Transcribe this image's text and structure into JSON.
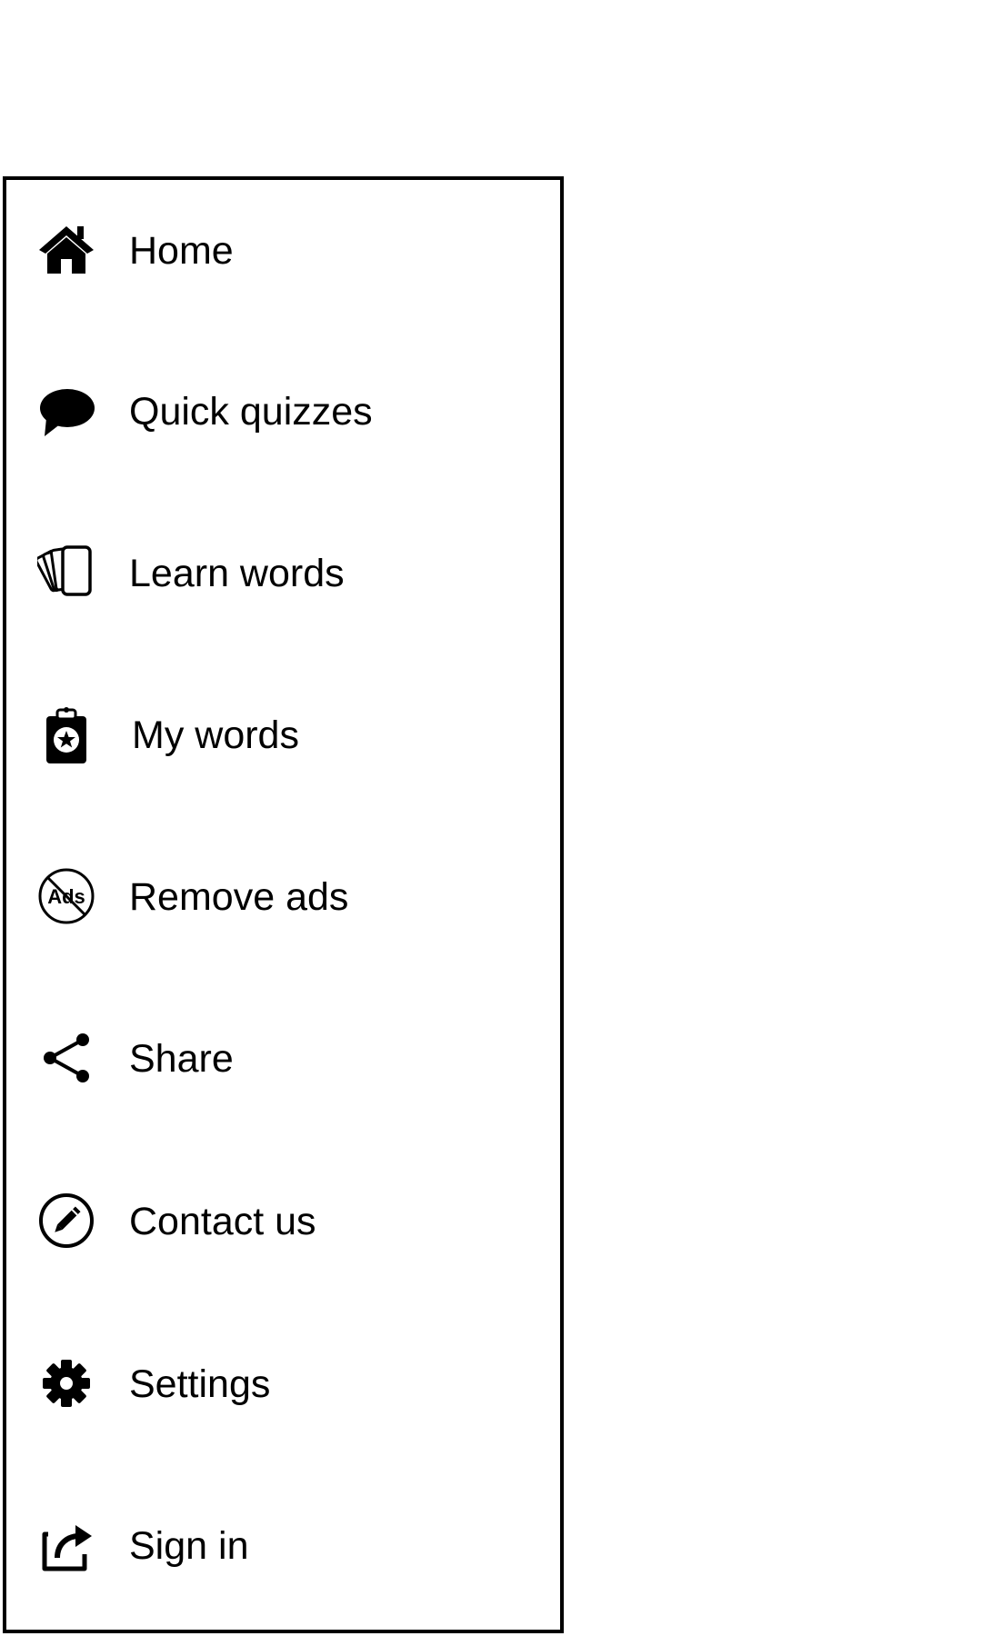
{
  "drawer": {
    "items": [
      {
        "label": "Home",
        "icon": "home-icon"
      },
      {
        "label": "Quick quizzes",
        "icon": "speech-bubble-icon"
      },
      {
        "label": "Learn words",
        "icon": "cards-icon"
      },
      {
        "label": "My words",
        "icon": "clipboard-star-icon"
      },
      {
        "label": "Remove ads",
        "icon": "no-ads-icon"
      },
      {
        "label": "Share",
        "icon": "share-icon"
      },
      {
        "label": "Contact us",
        "icon": "pencil-circle-icon"
      },
      {
        "label": "Settings",
        "icon": "gear-icon"
      },
      {
        "label": "Sign in",
        "icon": "sign-in-icon"
      }
    ],
    "icon_text": {
      "no_ads": "Ads"
    }
  }
}
